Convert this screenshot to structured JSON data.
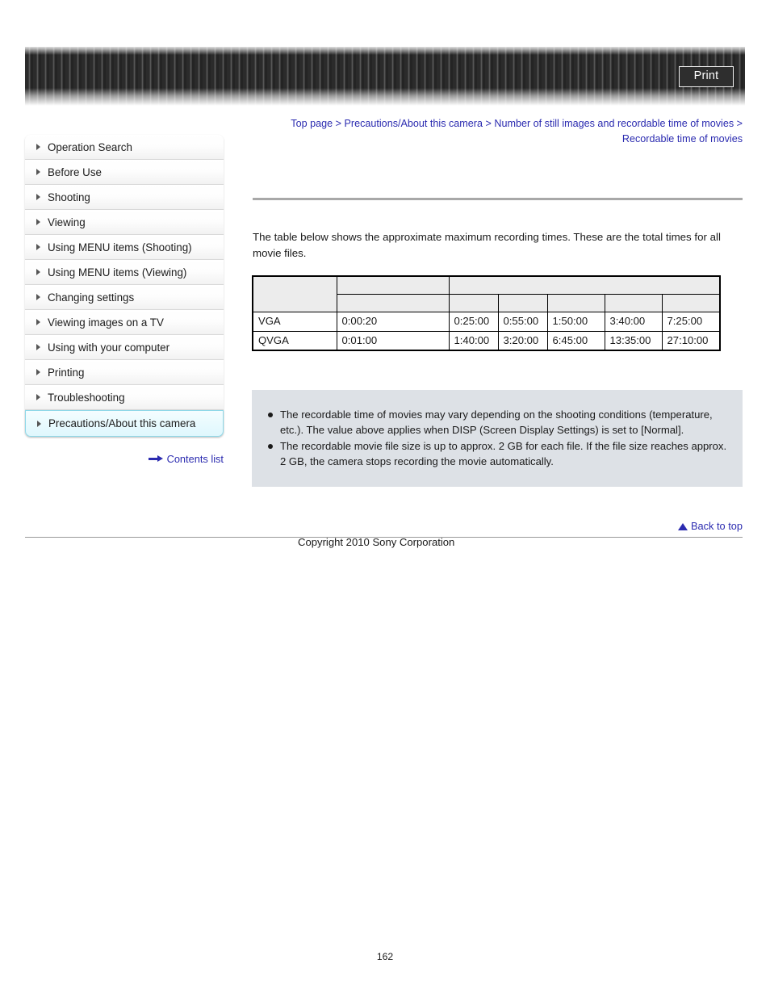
{
  "header": {
    "print_label": "Print"
  },
  "breadcrumb": {
    "separator": ">",
    "items": [
      "Top page",
      "Precautions/About this camera",
      "Number of still images and recordable time of movies",
      "Recordable time of movies"
    ]
  },
  "sidebar": {
    "items": [
      {
        "label": "Operation Search",
        "active": false
      },
      {
        "label": "Before Use",
        "active": false
      },
      {
        "label": "Shooting",
        "active": false
      },
      {
        "label": "Viewing",
        "active": false
      },
      {
        "label": "Using MENU items (Shooting)",
        "active": false
      },
      {
        "label": "Using MENU items (Viewing)",
        "active": false
      },
      {
        "label": "Changing settings",
        "active": false
      },
      {
        "label": "Viewing images on a TV",
        "active": false
      },
      {
        "label": "Using with your computer",
        "active": false
      },
      {
        "label": "Printing",
        "active": false
      },
      {
        "label": "Troubleshooting",
        "active": false
      },
      {
        "label": "Precautions/About this camera",
        "active": true
      }
    ],
    "contents_list_label": "Contents list"
  },
  "main": {
    "intro": "The table below shows the approximate maximum recording times. These are the total times for all movie files.",
    "table": {
      "header_row_1": [
        "",
        "",
        ""
      ],
      "header_row_2": [
        "",
        "",
        "",
        "",
        "",
        "",
        ""
      ],
      "rows": [
        {
          "cells": [
            "VGA",
            "0:00:20",
            "0:25:00",
            "0:55:00",
            "1:50:00",
            "3:40:00",
            "7:25:00"
          ]
        },
        {
          "cells": [
            "QVGA",
            "0:01:00",
            "1:40:00",
            "3:20:00",
            "6:45:00",
            "13:35:00",
            "27:10:00"
          ]
        }
      ]
    },
    "notes": [
      "The recordable time of movies may vary depending on the shooting conditions (temperature, etc.). The value above applies when DISP (Screen Display Settings) is set to [Normal].",
      "The recordable movie file size is up to approx. 2 GB for each file. If the file size reaches approx. 2 GB, the camera stops recording the movie automatically."
    ]
  },
  "footer": {
    "back_to_top_label": "Back to top",
    "copyright": "Copyright 2010 Sony Corporation",
    "page_number": "162"
  },
  "colors": {
    "link": "#2b2bb0",
    "active_nav_border": "#8fd8e8",
    "notes_bg": "#dde1e6",
    "table_header_bg": "#ececec"
  }
}
